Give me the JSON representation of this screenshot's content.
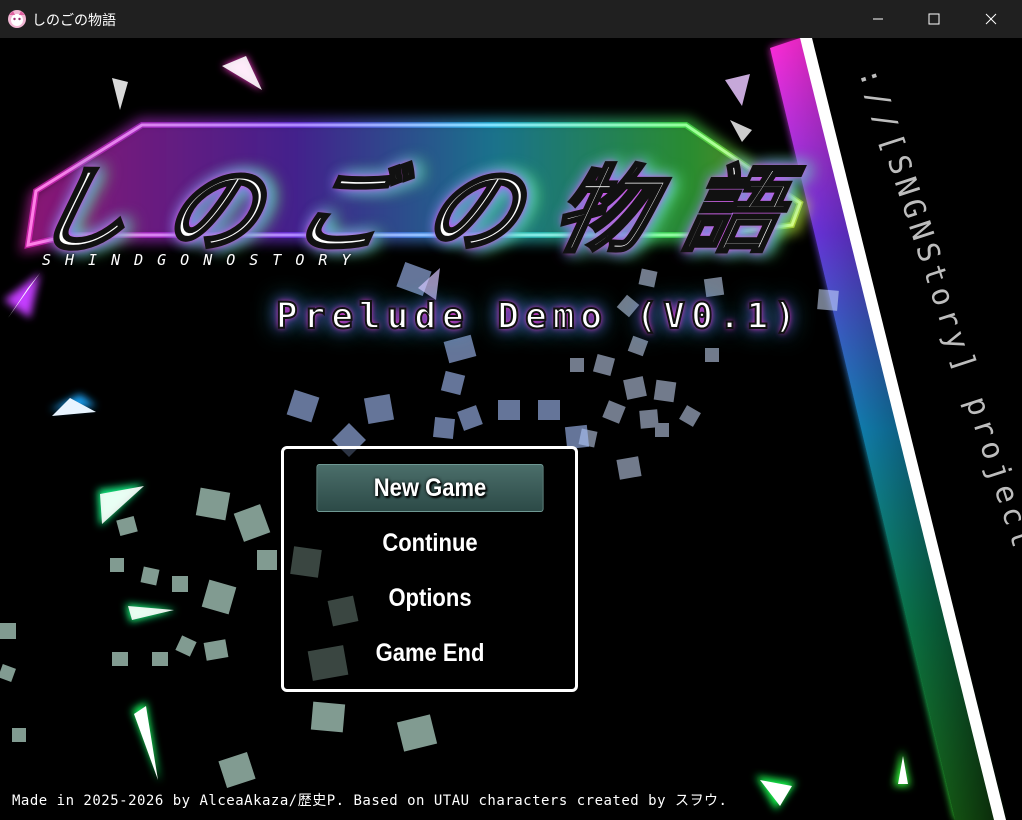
{
  "window": {
    "title": "しのごの物語",
    "minimize_label": "Minimize",
    "maximize_label": "Maximize",
    "close_label": "Close"
  },
  "game": {
    "logo_title": "しのごの物語",
    "logo_subtitle": "SHINDGONOSTORY",
    "subtitle": "Prelude Demo (V0.1)",
    "side_text": "://[SNGNStory] project",
    "credits": "Made in 2025-2026 by AlceaAkaza/歴史P. Based on UTAU characters created by スヲウ."
  },
  "menu": {
    "items": [
      {
        "label": "New Game",
        "selected": true
      },
      {
        "label": "Continue",
        "selected": false
      },
      {
        "label": "Options",
        "selected": false
      },
      {
        "label": "Game End",
        "selected": false
      }
    ]
  },
  "colors": {
    "titlebar": "#202020",
    "menu_highlight": "#3f5f5c",
    "accent_pink": "#ff4bd8",
    "accent_cyan": "#32e6ff",
    "accent_green": "#7aff5a"
  },
  "icons": {
    "app": "app-icon",
    "minimize": "minimize-icon",
    "maximize": "maximize-icon",
    "close": "close-icon"
  }
}
